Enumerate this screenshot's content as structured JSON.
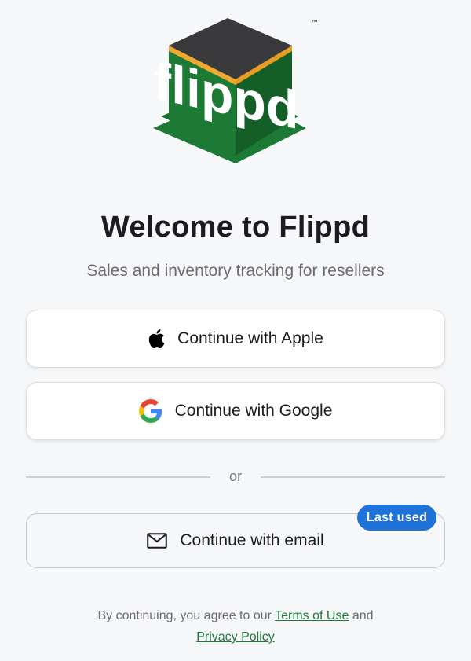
{
  "logo": {
    "wordmark": "flippd",
    "trademark": "™",
    "colors": {
      "top": "#3a3a3c",
      "stripe": "#f0a830",
      "green": "#1d7a34",
      "dark_green": "#135f27"
    }
  },
  "title": "Welcome to Flippd",
  "subtitle": "Sales and inventory tracking for resellers",
  "buttons": {
    "apple": {
      "label": "Continue with Apple",
      "icon": "apple-icon"
    },
    "google": {
      "label": "Continue with Google",
      "icon": "google-icon"
    },
    "email": {
      "label": "Continue with email",
      "icon": "mail-icon"
    }
  },
  "divider": {
    "label": "or"
  },
  "badge": {
    "label": "Last used",
    "color": "#1f73d8"
  },
  "legal": {
    "prefix": "By continuing, you agree to our",
    "terms_label": "Terms of Use",
    "conjunction": "and",
    "privacy_label": "Privacy Policy",
    "link_color": "#1f7a3a"
  }
}
